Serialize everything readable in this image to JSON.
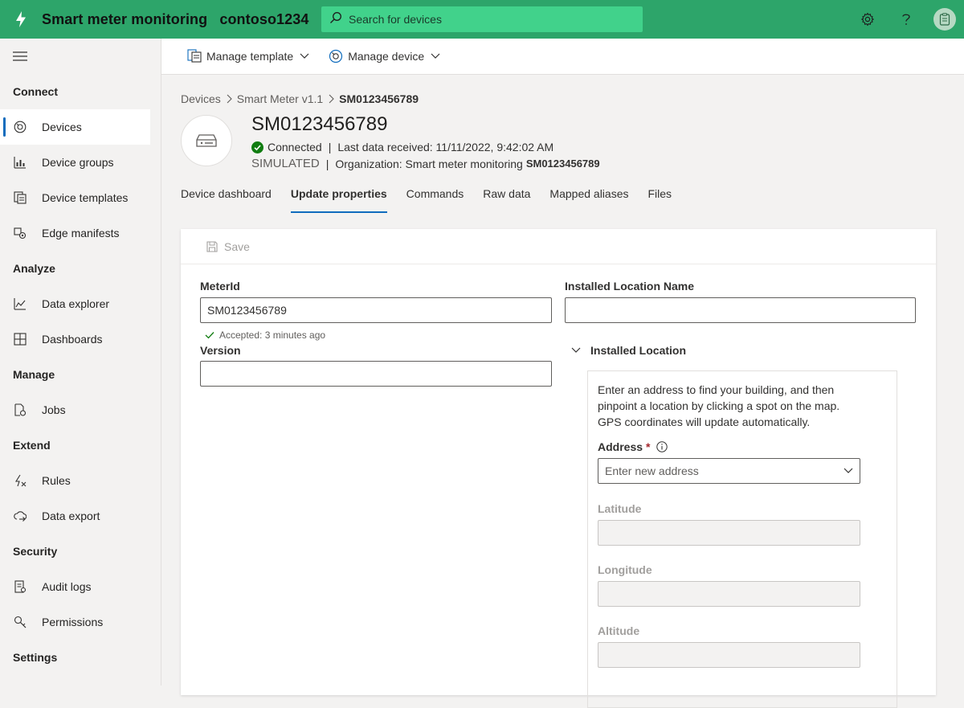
{
  "header": {
    "app_name": "Smart meter monitoring",
    "org_name": "contoso1234",
    "search_placeholder": "Search for devices",
    "brand_color": "#2da56a"
  },
  "icons": {
    "logo": "lightning-bolt-icon",
    "search": "search-icon",
    "settings": "gear-icon",
    "help": "help-icon",
    "account": "avatar-icon"
  },
  "sidebar": {
    "sections": [
      {
        "title": "Connect",
        "items": [
          {
            "label": "Devices",
            "icon": "devices-icon",
            "active": true
          },
          {
            "label": "Device groups",
            "icon": "device-groups-icon"
          },
          {
            "label": "Device templates",
            "icon": "device-templates-icon"
          },
          {
            "label": "Edge manifests",
            "icon": "edge-manifests-icon"
          }
        ]
      },
      {
        "title": "Analyze",
        "items": [
          {
            "label": "Data explorer",
            "icon": "chart-line-icon"
          },
          {
            "label": "Dashboards",
            "icon": "dashboard-icon"
          }
        ]
      },
      {
        "title": "Manage",
        "items": [
          {
            "label": "Jobs",
            "icon": "jobs-icon"
          }
        ]
      },
      {
        "title": "Extend",
        "items": [
          {
            "label": "Rules",
            "icon": "rules-icon"
          },
          {
            "label": "Data export",
            "icon": "data-export-icon"
          }
        ]
      },
      {
        "title": "Security",
        "items": [
          {
            "label": "Audit logs",
            "icon": "audit-logs-icon"
          },
          {
            "label": "Permissions",
            "icon": "permissions-icon"
          }
        ]
      },
      {
        "title": "Settings",
        "items": []
      }
    ]
  },
  "commandbar": {
    "manage_template": "Manage template",
    "manage_device": "Manage device"
  },
  "breadcrumb": {
    "items": [
      "Devices",
      "Smart Meter v1.1",
      "SM0123456789"
    ]
  },
  "device": {
    "name": "SM0123456789",
    "status": "Connected",
    "last_data": "Last data received: 11/11/2022, 9:42:02 AM",
    "type": "SIMULATED",
    "organization_label": "Organization: Smart meter monitoring",
    "organization_id": "SM0123456789"
  },
  "tabs": [
    "Device dashboard",
    "Update properties",
    "Commands",
    "Raw data",
    "Mapped aliases",
    "Files"
  ],
  "form": {
    "save_label": "Save",
    "meter_id_label": "MeterId",
    "meter_id_value": "SM0123456789",
    "meter_id_status": "Accepted: 3 minutes ago",
    "version_label": "Version",
    "version_value": "",
    "installed_location_name_label": "Installed Location Name",
    "installed_location_name_value": "",
    "installed_location_label": "Installed Location",
    "location_description": "Enter an address to find your building, and then pinpoint a location by clicking a spot on the map. GPS coordinates will update automatically.",
    "address_label": "Address",
    "address_required_mark": "*",
    "address_placeholder": "Enter new address",
    "latitude_label": "Latitude",
    "longitude_label": "Longitude",
    "altitude_label": "Altitude"
  }
}
